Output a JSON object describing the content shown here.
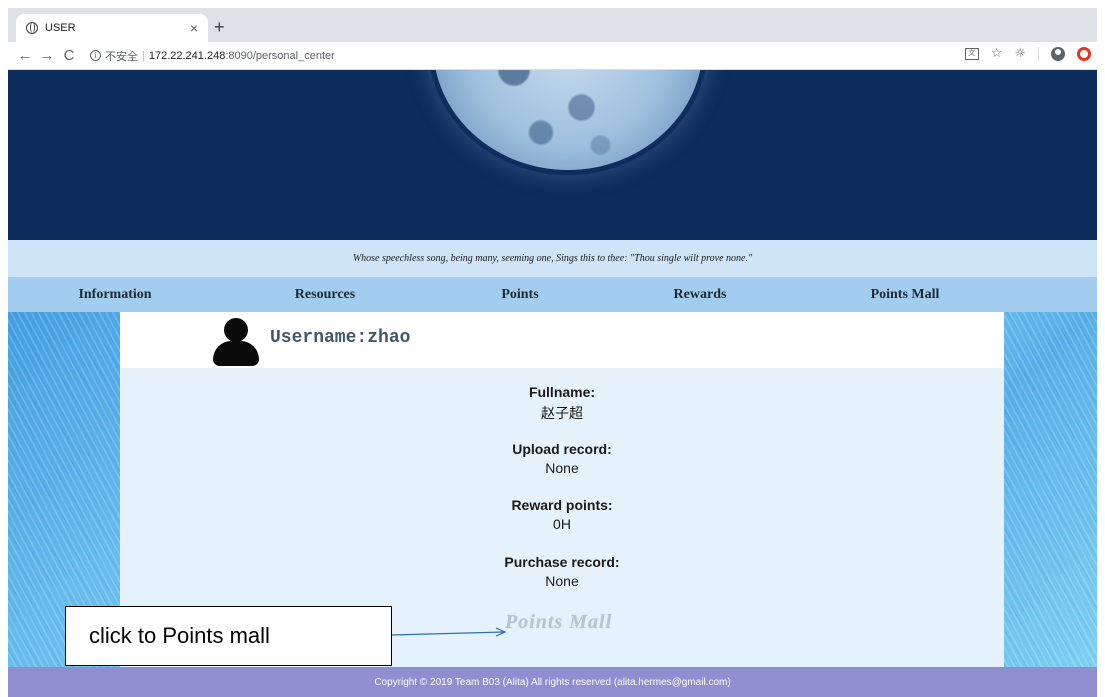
{
  "browser": {
    "tab_title": "USER",
    "tab_close": "×",
    "new_tab": "+",
    "nav": {
      "back": "←",
      "forward": "→",
      "reload": "C"
    },
    "info_glyph": "i",
    "insecure_label": "不安全",
    "separator": "|",
    "url_host": "172.22.241.248",
    "url_rest": ":8090/personal_center",
    "toolbar_icons": [
      "translate-icon",
      "star-icon",
      "extension-icon",
      "account-icon",
      "opera-icon"
    ],
    "translate_glyph": "文",
    "star_glyph": "☆",
    "extension_glyph": "☼"
  },
  "page": {
    "quote": "Whose speechless song, being many, seeming one, Sings this to thee: \"Thou single wilt prove none.\"",
    "nav": [
      {
        "label": "Information"
      },
      {
        "label": "Resources"
      },
      {
        "label": "Points"
      },
      {
        "label": "Rewards"
      },
      {
        "label": "Points Mall"
      }
    ],
    "username_label": "Username:zhao",
    "fields": [
      {
        "label": "Fullname:",
        "value": "赵子超"
      },
      {
        "label": "Upload record:",
        "value": "None"
      },
      {
        "label": "Reward points:",
        "value": "0H"
      },
      {
        "label": "Purchase record:",
        "value": "None"
      }
    ],
    "points_mall_link": "Points Mall",
    "footer": "Copyright © 2019 Team B03 (Alita) All rights reserved (alita.hermes@gmail.com)"
  },
  "annotation": {
    "text": "click to Points mall"
  },
  "colors": {
    "banner": "#0d2d5c",
    "quote_bar": "#cfe4f6",
    "navbar": "#a2cdee",
    "card": "#e6f2fb",
    "footer": "#8e8ed1",
    "arrow": "#2e6db5"
  }
}
